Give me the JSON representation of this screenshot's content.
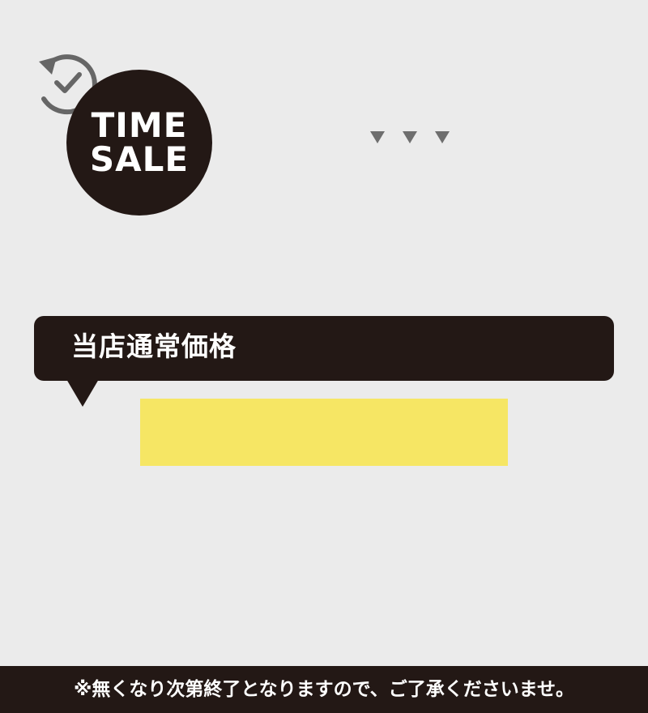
{
  "badge": {
    "line1": "TIME",
    "line2": "SALE",
    "icon": "clock-icon"
  },
  "indicator": {
    "icon": "triple-down-arrow-icon",
    "color": "#6e6e6e"
  },
  "price_label": {
    "text": "当店通常価格"
  },
  "price_box": {
    "color": "#f6e664"
  },
  "footer": {
    "note": "※無くなり次第終了となりますので、ご了承くださいませ。"
  },
  "colors": {
    "background": "#ebebeb",
    "dark": "#231815",
    "icon_gray": "#666666",
    "highlight": "#f6e664"
  }
}
